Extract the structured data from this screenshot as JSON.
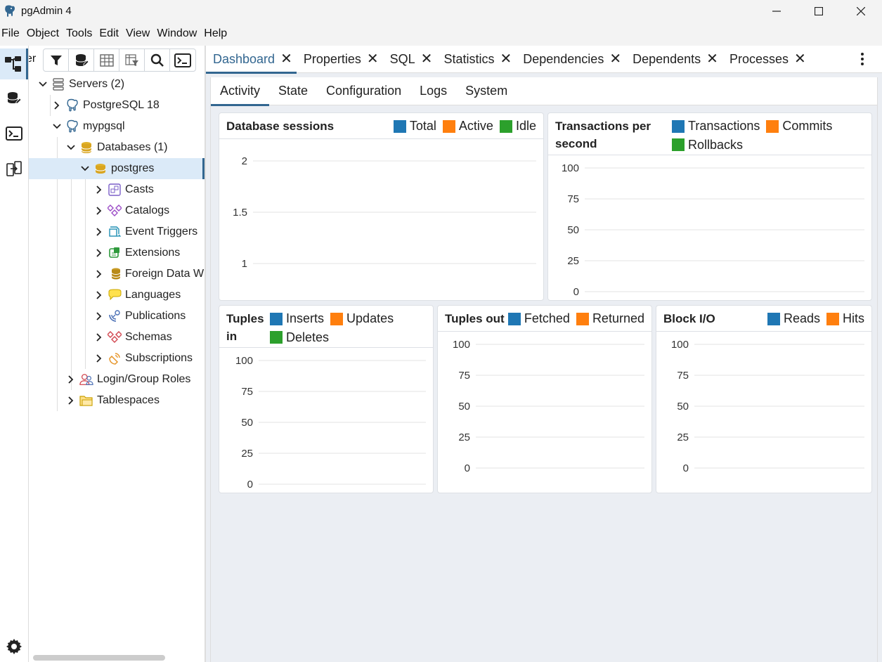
{
  "window": {
    "title": "pgAdmin 4",
    "controls": {
      "minimize": "—",
      "maximize": "☐",
      "close": "✕"
    }
  },
  "menu": [
    "File",
    "Object",
    "Tools",
    "Edit",
    "View",
    "Window",
    "Help"
  ],
  "explorer": {
    "title_fragment": "er",
    "toolbar_icons": [
      "filter-icon",
      "query-tool-icon",
      "view-data-icon",
      "filtered-rows-icon",
      "search-objects-icon",
      "psql-tool-icon"
    ],
    "tree": [
      {
        "label": "Servers (2)",
        "level": 0,
        "chevron": "down",
        "icon": "servers-icon"
      },
      {
        "label": "PostgreSQL 18",
        "level": 1,
        "chevron": "right",
        "icon": "elephant-icon"
      },
      {
        "label": "mypgsql",
        "level": 1,
        "chevron": "down",
        "icon": "elephant-icon"
      },
      {
        "label": "Databases (1)",
        "level": 2,
        "chevron": "down",
        "icon": "databases-icon"
      },
      {
        "label": "postgres",
        "level": 3,
        "chevron": "down",
        "icon": "database-icon",
        "selected": true
      },
      {
        "label": "Casts",
        "level": 4,
        "chevron": "right",
        "icon": "casts-icon"
      },
      {
        "label": "Catalogs",
        "level": 4,
        "chevron": "right",
        "icon": "catalogs-icon"
      },
      {
        "label": "Event Triggers",
        "level": 4,
        "chevron": "right",
        "icon": "event-triggers-icon"
      },
      {
        "label": "Extensions",
        "level": 4,
        "chevron": "right",
        "icon": "extensions-icon"
      },
      {
        "label": "Foreign Data W",
        "level": 4,
        "chevron": "right",
        "icon": "foreign-data-wrapper-icon"
      },
      {
        "label": "Languages",
        "level": 4,
        "chevron": "right",
        "icon": "languages-icon"
      },
      {
        "label": "Publications",
        "level": 4,
        "chevron": "right",
        "icon": "publications-icon"
      },
      {
        "label": "Schemas",
        "level": 4,
        "chevron": "right",
        "icon": "schemas-icon"
      },
      {
        "label": "Subscriptions",
        "level": 4,
        "chevron": "right",
        "icon": "subscriptions-icon"
      },
      {
        "label": "Login/Group Roles",
        "level": 2,
        "chevron": "right",
        "icon": "roles-icon"
      },
      {
        "label": "Tablespaces",
        "level": 2,
        "chevron": "right",
        "icon": "tablespaces-icon"
      }
    ]
  },
  "tabs": [
    {
      "label": "Dashboard",
      "active": true
    },
    {
      "label": "Properties"
    },
    {
      "label": "SQL"
    },
    {
      "label": "Statistics"
    },
    {
      "label": "Dependencies"
    },
    {
      "label": "Dependents"
    },
    {
      "label": "Processes"
    }
  ],
  "close_glyph": "✕",
  "subtabs": [
    {
      "label": "Activity",
      "active": true
    },
    {
      "label": "State"
    },
    {
      "label": "Configuration"
    },
    {
      "label": "Logs"
    },
    {
      "label": "System"
    }
  ],
  "colors": {
    "blue": "#1f77b4",
    "orange": "#ff7f0e",
    "green": "#2ca02c",
    "accent": "#326690"
  },
  "cards": {
    "sessions": {
      "title": "Database sessions",
      "legend": [
        {
          "name": "Total",
          "color": "#1f77b4"
        },
        {
          "name": "Active",
          "color": "#ff7f0e"
        },
        {
          "name": "Idle",
          "color": "#2ca02c"
        }
      ]
    },
    "tps": {
      "title_line1": "Transactions per",
      "title_line2": "second",
      "legend": [
        {
          "name": "Transactions",
          "color": "#1f77b4"
        },
        {
          "name": "Commits",
          "color": "#ff7f0e"
        },
        {
          "name": "Rollbacks",
          "color": "#2ca02c"
        }
      ]
    },
    "tuples_in": {
      "title_line1": "Tuples",
      "title_line2": "in",
      "legend": [
        {
          "name": "Inserts",
          "color": "#1f77b4"
        },
        {
          "name": "Updates",
          "color": "#ff7f0e"
        },
        {
          "name": "Deletes",
          "color": "#2ca02c"
        }
      ]
    },
    "tuples_out": {
      "title": "Tuples out",
      "legend": [
        {
          "name": "Fetched",
          "color": "#1f77b4"
        },
        {
          "name": "Returned",
          "color": "#ff7f0e"
        }
      ]
    },
    "block_io": {
      "title": "Block I/O",
      "legend": [
        {
          "name": "Reads",
          "color": "#1f77b4"
        },
        {
          "name": "Hits",
          "color": "#ff7f0e"
        }
      ]
    }
  },
  "chart_data": [
    {
      "id": "sessions",
      "type": "line",
      "title": "Database sessions",
      "yticks": [
        "2",
        "1.5",
        "1"
      ],
      "series": [
        {
          "name": "Total",
          "values": []
        },
        {
          "name": "Active",
          "values": []
        },
        {
          "name": "Idle",
          "values": []
        }
      ]
    },
    {
      "id": "tps",
      "type": "line",
      "title": "Transactions per second",
      "yticks": [
        "100",
        "75",
        "50",
        "25",
        "0"
      ],
      "series": [
        {
          "name": "Transactions",
          "values": []
        },
        {
          "name": "Commits",
          "values": []
        },
        {
          "name": "Rollbacks",
          "values": []
        }
      ]
    },
    {
      "id": "tuples_in",
      "type": "line",
      "title": "Tuples in",
      "yticks": [
        "100",
        "75",
        "50",
        "25",
        "0"
      ],
      "series": [
        {
          "name": "Inserts",
          "values": []
        },
        {
          "name": "Updates",
          "values": []
        },
        {
          "name": "Deletes",
          "values": []
        }
      ]
    },
    {
      "id": "tuples_out",
      "type": "line",
      "title": "Tuples out",
      "yticks": [
        "100",
        "75",
        "50",
        "25",
        "0"
      ],
      "series": [
        {
          "name": "Fetched",
          "values": []
        },
        {
          "name": "Returned",
          "values": []
        }
      ]
    },
    {
      "id": "block_io",
      "type": "line",
      "title": "Block I/O",
      "yticks": [
        "100",
        "75",
        "50",
        "25",
        "0"
      ],
      "series": [
        {
          "name": "Reads",
          "values": []
        },
        {
          "name": "Hits",
          "values": []
        }
      ]
    }
  ]
}
